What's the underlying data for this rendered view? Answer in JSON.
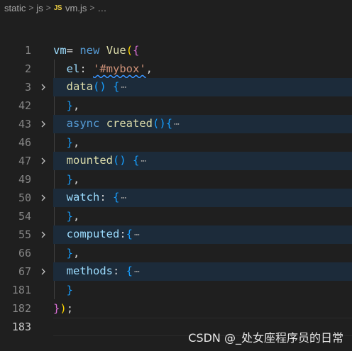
{
  "breadcrumb": {
    "items": [
      "static",
      "js",
      "vm.js",
      "…"
    ],
    "file_icon": "JS"
  },
  "editor": {
    "lines": [
      {
        "num": "1"
      },
      {
        "num": "2"
      },
      {
        "num": "3"
      },
      {
        "num": "42"
      },
      {
        "num": "43"
      },
      {
        "num": "46"
      },
      {
        "num": "47"
      },
      {
        "num": "49"
      },
      {
        "num": "50"
      },
      {
        "num": "54"
      },
      {
        "num": "55"
      },
      {
        "num": "66"
      },
      {
        "num": "67"
      },
      {
        "num": "181"
      },
      {
        "num": "182"
      },
      {
        "num": "183"
      }
    ],
    "tokens": {
      "vm": "vm",
      "eq": "= ",
      "new": "new",
      "vue": "Vue",
      "el": "el",
      "colon_space": ": ",
      "mybox": "'#mybox'",
      "comma": ",",
      "data": "data",
      "async": "async",
      "created": "created",
      "mounted": "mounted",
      "watch": "watch",
      "computed": "computed",
      "methods": "methods",
      "ellipsis": "⋯",
      "close_brace_comma": "},",
      "semicolon": ";"
    }
  },
  "watermark": "CSDN @_处女座程序员的日常",
  "icons": [
    "js-file-icon",
    "chevron-right-icon",
    "fold-chevron-icon"
  ]
}
